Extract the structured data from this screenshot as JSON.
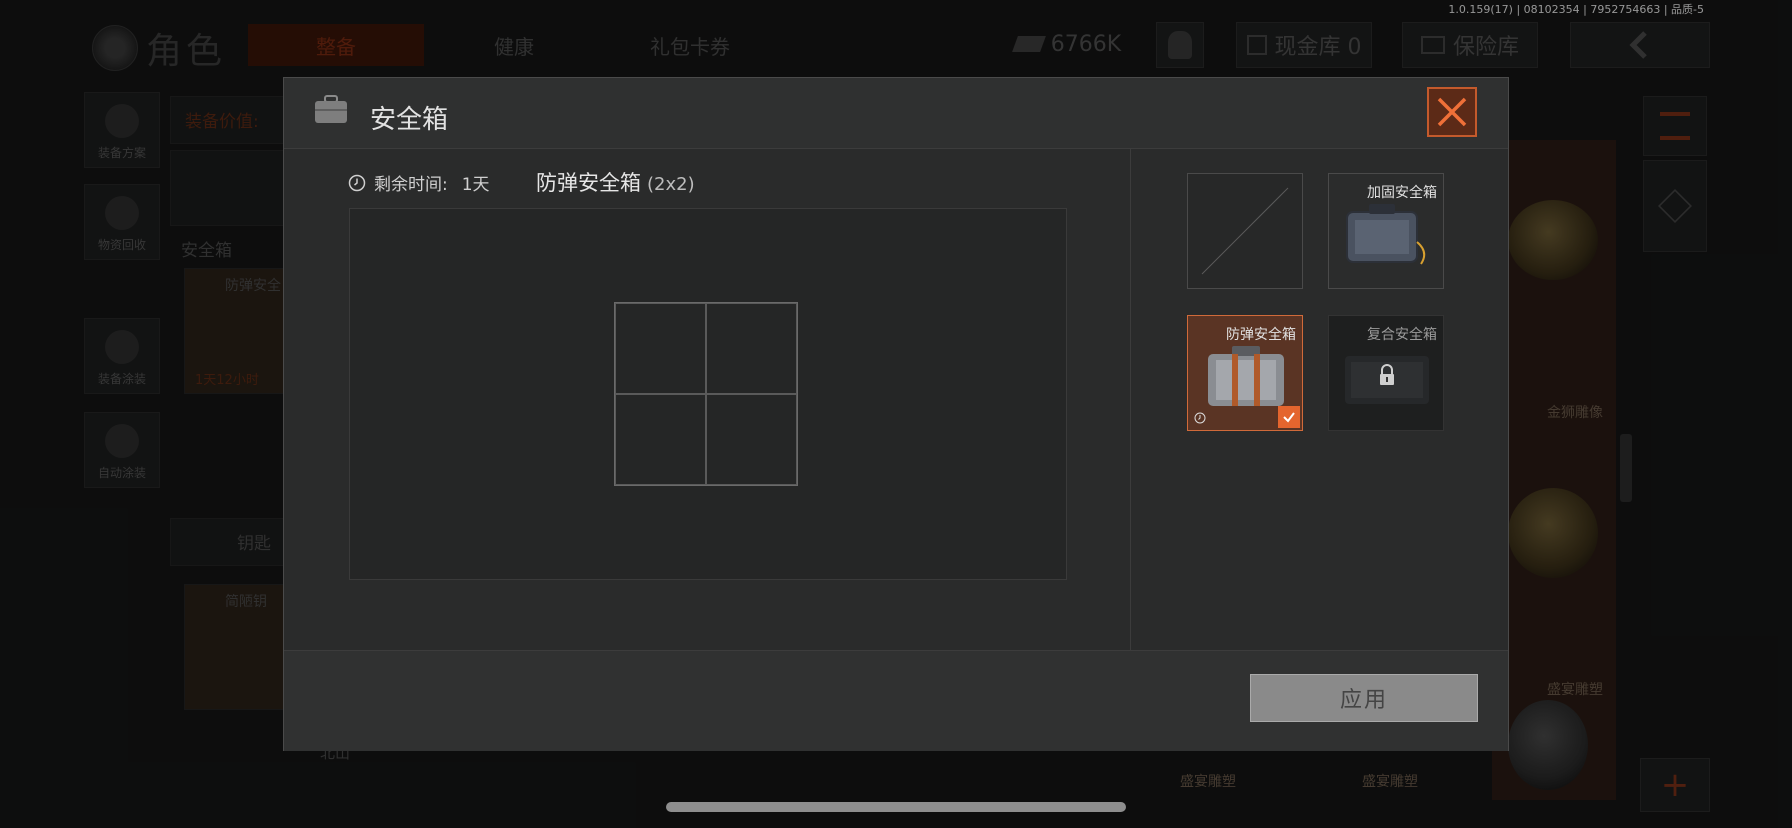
{
  "version": "1.0.159(17) | 08102354 | 7952754663 | 品质-5",
  "header": {
    "title": "角色",
    "tabs": [
      "整备",
      "健康",
      "礼包卡券"
    ],
    "currency": "6766K",
    "cash_vault": "现金库 0",
    "safe_vault": "保险库"
  },
  "left_nav": [
    "装备方案",
    "物资回收",
    "装备涂装",
    "自动涂装"
  ],
  "background": {
    "equip_value": "装备价值:",
    "safe_box_section": "安全箱",
    "safe_box_item": "防弹安全",
    "timer": "1天12小时",
    "key_section": "钥匙",
    "key_item": "简陋钥",
    "bottom_label": "北山",
    "right_items": [
      "金狮雕像",
      "盛宴雕塑",
      "盛宴雕塑",
      "盛宴雕塑"
    ]
  },
  "modal": {
    "title": "安全箱",
    "remaining_label": "剩余时间:",
    "remaining_value": "1天",
    "selected_name": "防弹安全箱",
    "selected_size": "(2x2)",
    "apply": "应用",
    "slots": [
      {
        "label": ""
      },
      {
        "label": "加固安全箱"
      },
      {
        "label": "防弹安全箱",
        "selected": true
      },
      {
        "label": "复合安全箱",
        "locked": true
      }
    ]
  },
  "colors": {
    "accent": "#e4652e",
    "close_bg": "#5c2a17",
    "selected_bg": "#5a3424"
  }
}
